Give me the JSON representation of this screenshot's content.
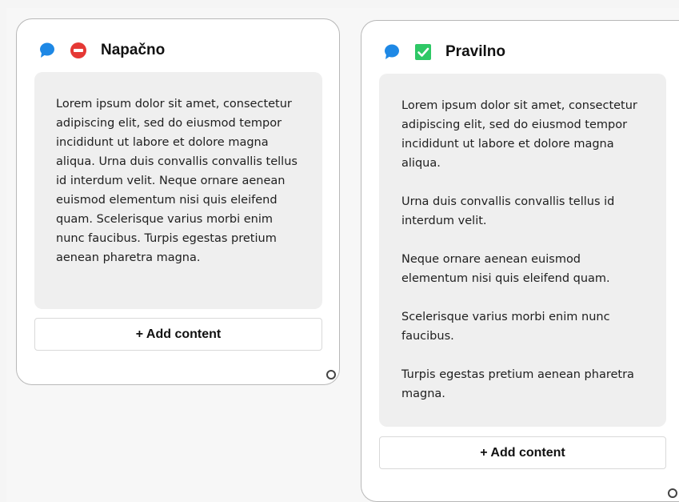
{
  "cards": [
    {
      "title": "Napačno",
      "status": "incorrect",
      "status_icon": "no-entry-icon",
      "comment_icon": "speech-bubble-icon",
      "paragraphs": [
        "Lorem ipsum dolor sit amet, consectetur adipiscing elit, sed do eiusmod tempor incididunt ut labore et dolore magna aliqua. Urna duis convallis convallis tellus id interdum velit. Neque ornare aenean euismod elementum nisi quis eleifend quam. Scelerisque varius morbi enim nunc faucibus. Turpis egestas pretium aenean pharetra magna."
      ],
      "add_label": "+ Add content"
    },
    {
      "title": "Pravilno",
      "status": "correct",
      "status_icon": "check-box-icon",
      "comment_icon": "speech-bubble-icon",
      "paragraphs": [
        "Lorem ipsum dolor sit amet, consectetur adipiscing elit, sed do eiusmod tempor incididunt ut labore et dolore magna aliqua.",
        "Urna duis convallis convallis tellus id interdum velit.",
        "Neque ornare aenean euismod elementum nisi quis eleifend quam.",
        "Scelerisque varius morbi enim nunc faucibus.",
        "Turpis egestas pretium aenean pharetra magna."
      ],
      "add_label": "+ Add content"
    }
  ],
  "colors": {
    "comment_blue": "#1e88e5",
    "incorrect_red": "#e53935",
    "correct_green": "#2ec866"
  }
}
